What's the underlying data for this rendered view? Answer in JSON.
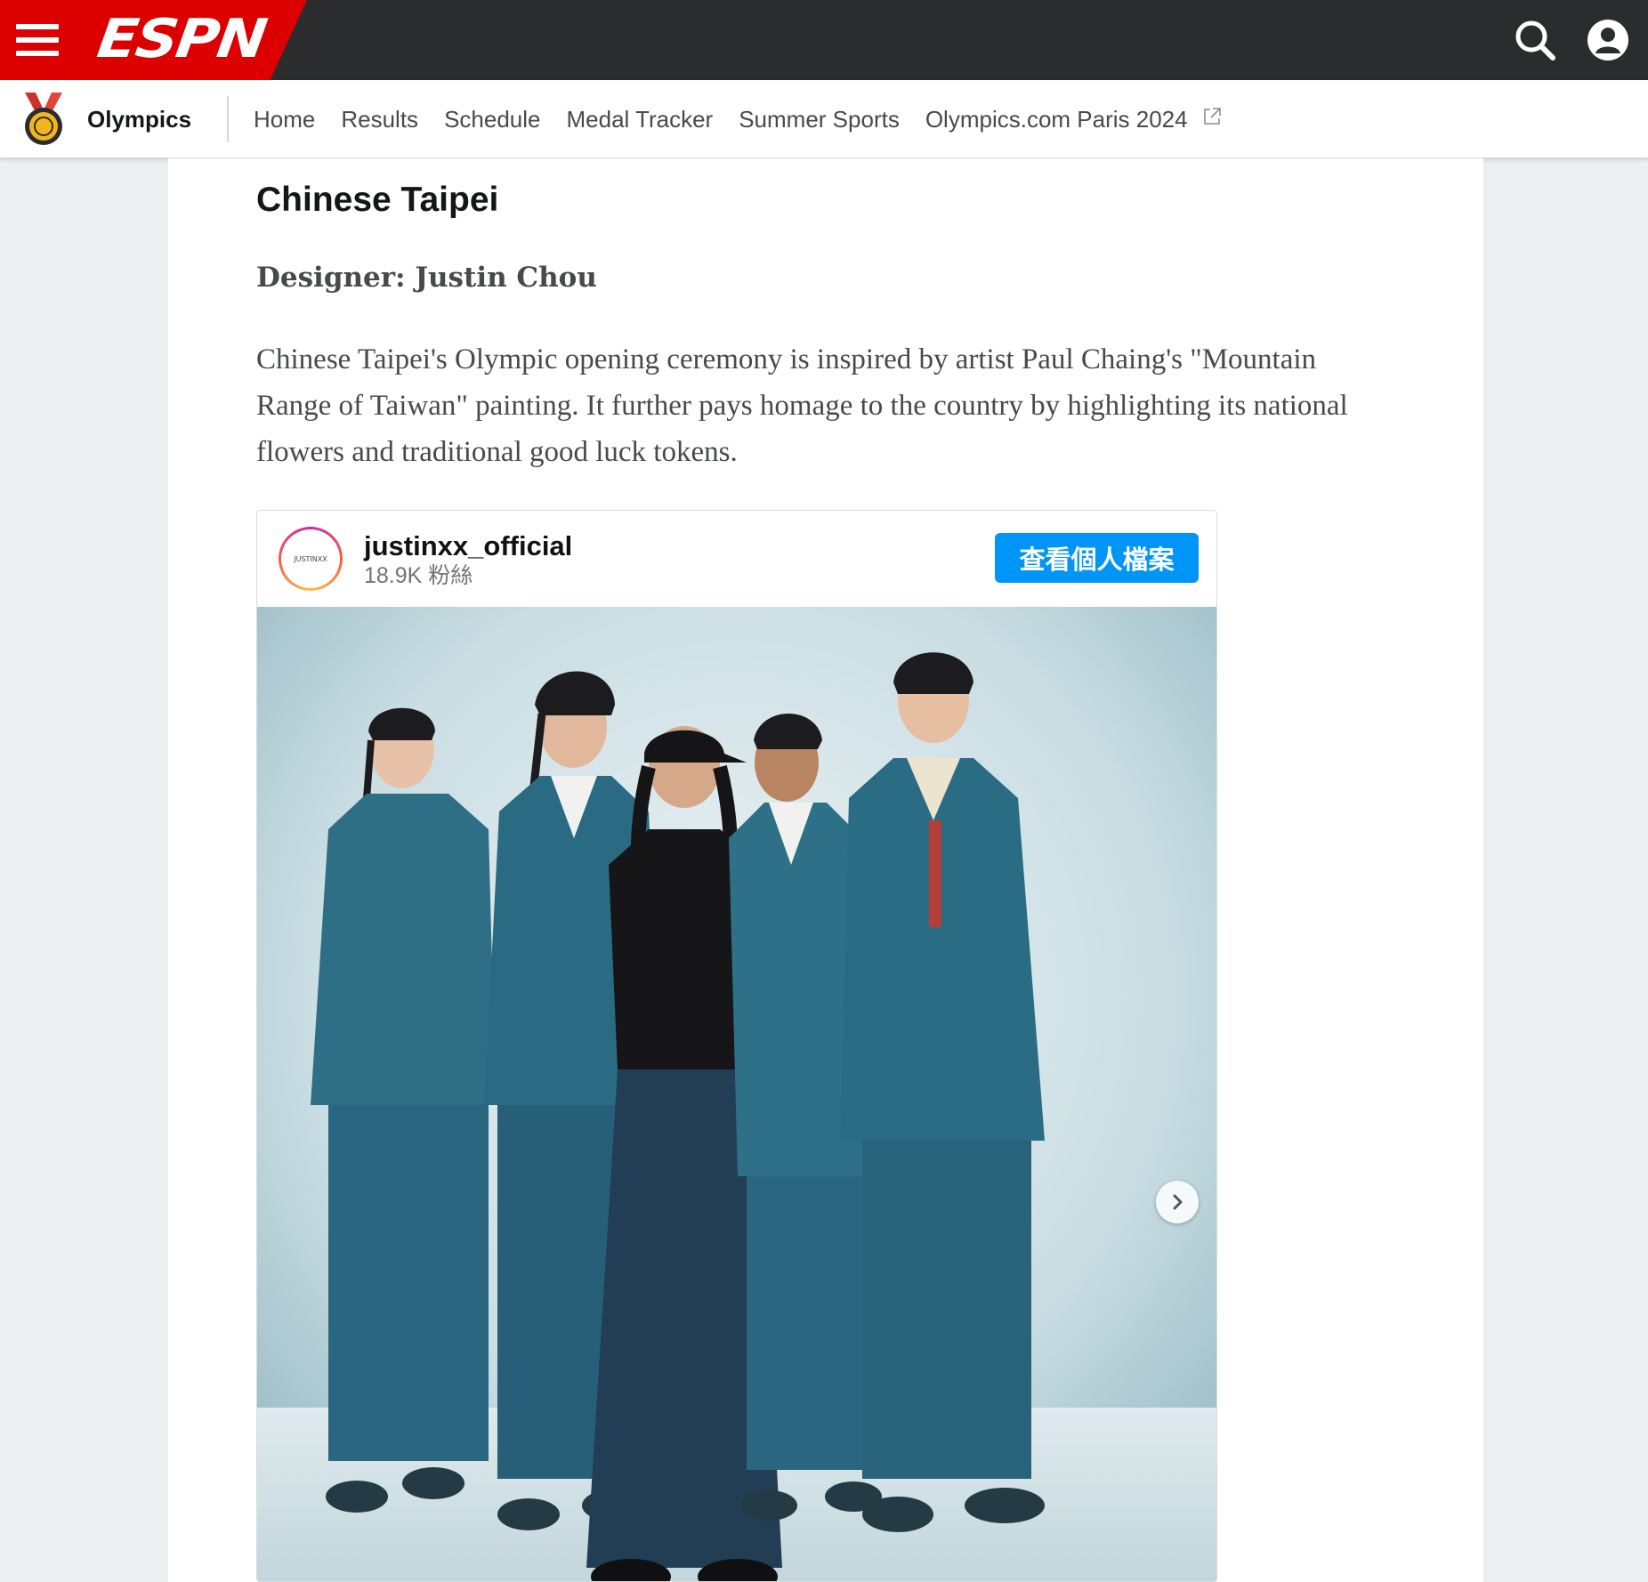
{
  "header": {
    "logo_text": "ESPN",
    "brand_color": "#dd0000"
  },
  "subnav": {
    "section": "Olympics",
    "links": [
      "Home",
      "Results",
      "Schedule",
      "Medal Tracker",
      "Summer Sports",
      "Olympics.com Paris 2024"
    ]
  },
  "article": {
    "country_heading": "Chinese Taipei",
    "designer_heading": "Designer: Justin Chou",
    "body": "Chinese Taipei's Olympic opening ceremony is inspired by artist Paul Chaing's \"Mountain Range of Taiwan\" painting. It further pays homage to the country by highlighting its national flowers and traditional good luck tokens."
  },
  "instagram": {
    "avatar_text": "JUSTINXX",
    "username": "justinxx_official",
    "followers": "18.9K 粉絲",
    "view_profile_label": "查看個人檔案",
    "button_color": "#0095f6"
  }
}
